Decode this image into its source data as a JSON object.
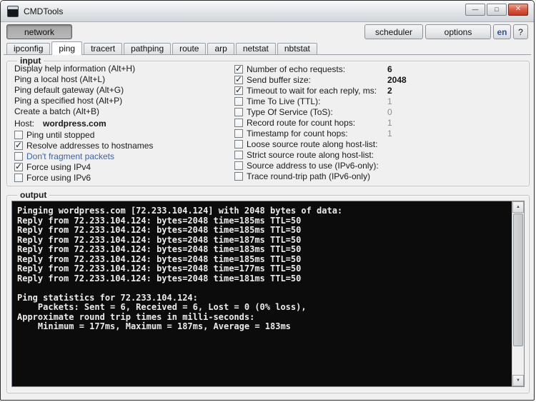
{
  "window": {
    "title": "CMDTools"
  },
  "icons": {
    "minimize": "—",
    "maximize": "□",
    "close": "✕",
    "scroll_up": "▲",
    "scroll_down": "▼"
  },
  "toolbar": {
    "network": "network",
    "scheduler": "scheduler",
    "options": "options",
    "language": "en",
    "help": "?"
  },
  "tabs": {
    "active": "ping",
    "items": [
      {
        "label": "ipconfig"
      },
      {
        "label": "ping",
        "active": true
      },
      {
        "label": "tracert"
      },
      {
        "label": "pathping"
      },
      {
        "label": "route"
      },
      {
        "label": "arp"
      },
      {
        "label": "netstat"
      },
      {
        "label": "nbtstat"
      }
    ]
  },
  "input": {
    "group_label": "input",
    "commands": [
      "Display help information (Alt+H)",
      "Ping a local host (Alt+L)",
      "Ping default gateway (Alt+G)",
      "Ping a specified host (Alt+P)",
      "Create a batch (Alt+B)"
    ],
    "host": {
      "label": "Host:",
      "value": "wordpress.com"
    },
    "options_left": [
      {
        "label": "Ping until stopped",
        "checked": false
      },
      {
        "label": "Resolve addresses to hostnames",
        "checked": true
      },
      {
        "label": "Don't fragment packets",
        "checked": false,
        "label_color": "#3a62ad"
      },
      {
        "label": "Force using IPv4",
        "checked": true
      },
      {
        "label": "Force using IPv6",
        "checked": false
      }
    ],
    "options_right": [
      {
        "label": "Number of echo requests:",
        "checked": true,
        "value": "6"
      },
      {
        "label": "Send buffer size:",
        "checked": true,
        "value": "2048"
      },
      {
        "label": "Timeout to wait for each reply, ms:",
        "checked": true,
        "value": "2"
      },
      {
        "label": "Time To Live (TTL):",
        "checked": false,
        "value": "1"
      },
      {
        "label": "Type Of Service (ToS):",
        "checked": false,
        "value": "0"
      },
      {
        "label": "Record route for count hops:",
        "checked": false,
        "value": "1"
      },
      {
        "label": "Timestamp for count hops:",
        "checked": false,
        "value": "1"
      },
      {
        "label": "Loose source route along host-list:",
        "checked": false,
        "value": ""
      },
      {
        "label": "Strict source route along host-list:",
        "checked": false,
        "value": ""
      },
      {
        "label": "Source address to use (IPv6-only):",
        "checked": false,
        "value": ""
      },
      {
        "label": "Trace round-trip path (IPv6-only)",
        "checked": false,
        "value": ""
      }
    ]
  },
  "output": {
    "group_label": "output",
    "console_lines": [
      "Pinging wordpress.com [72.233.104.124] with 2048 bytes of data:",
      "Reply from 72.233.104.124: bytes=2048 time=185ms TTL=50",
      "Reply from 72.233.104.124: bytes=2048 time=185ms TTL=50",
      "Reply from 72.233.104.124: bytes=2048 time=187ms TTL=50",
      "Reply from 72.233.104.124: bytes=2048 time=183ms TTL=50",
      "Reply from 72.233.104.124: bytes=2048 time=185ms TTL=50",
      "Reply from 72.233.104.124: bytes=2048 time=177ms TTL=50",
      "Reply from 72.233.104.124: bytes=2048 time=181ms TTL=50",
      "",
      "Ping statistics for 72.233.104.124:",
      "    Packets: Sent = 6, Received = 6, Lost = 0 (0% loss),",
      "Approximate round trip times in milli-seconds:",
      "    Minimum = 177ms, Maximum = 187ms, Average = 183ms"
    ]
  },
  "colors": {
    "window_bg": "#f0f0f0",
    "console_bg": "#0c0c0c",
    "console_text": "#ececec",
    "link_blue": "#3a62ad",
    "close_button_red": "#c03822",
    "disabled_value_gray": "#8c8c8c"
  }
}
